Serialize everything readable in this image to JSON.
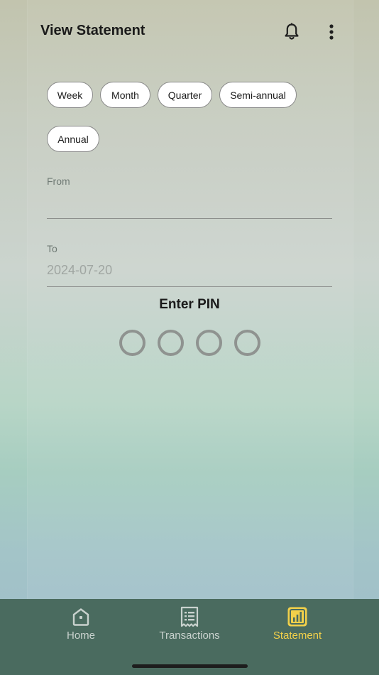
{
  "header": {
    "title": "View Statement",
    "bell_icon": "bell-icon",
    "more_icon": "more-vertical-icon"
  },
  "period_chips": [
    {
      "label": "Week"
    },
    {
      "label": "Month"
    },
    {
      "label": "Quarter"
    },
    {
      "label": "Semi-annual"
    },
    {
      "label": "Annual"
    }
  ],
  "from_field": {
    "label": "From",
    "value": "",
    "placeholder": ""
  },
  "to_field": {
    "label": "To",
    "value": "",
    "placeholder": "2024-07-20"
  },
  "pin": {
    "title": "Enter PIN",
    "digits_total": 4,
    "digits_entered": 0
  },
  "bottom_nav": {
    "items": [
      {
        "label": "Home",
        "icon": "home-icon",
        "active": false
      },
      {
        "label": "Transactions",
        "icon": "receipt-icon",
        "active": false
      },
      {
        "label": "Statement",
        "icon": "bar-chart-icon",
        "active": true
      }
    ]
  },
  "colors": {
    "accent": "#f2d04a",
    "nav_background": "#4a6b5f"
  }
}
